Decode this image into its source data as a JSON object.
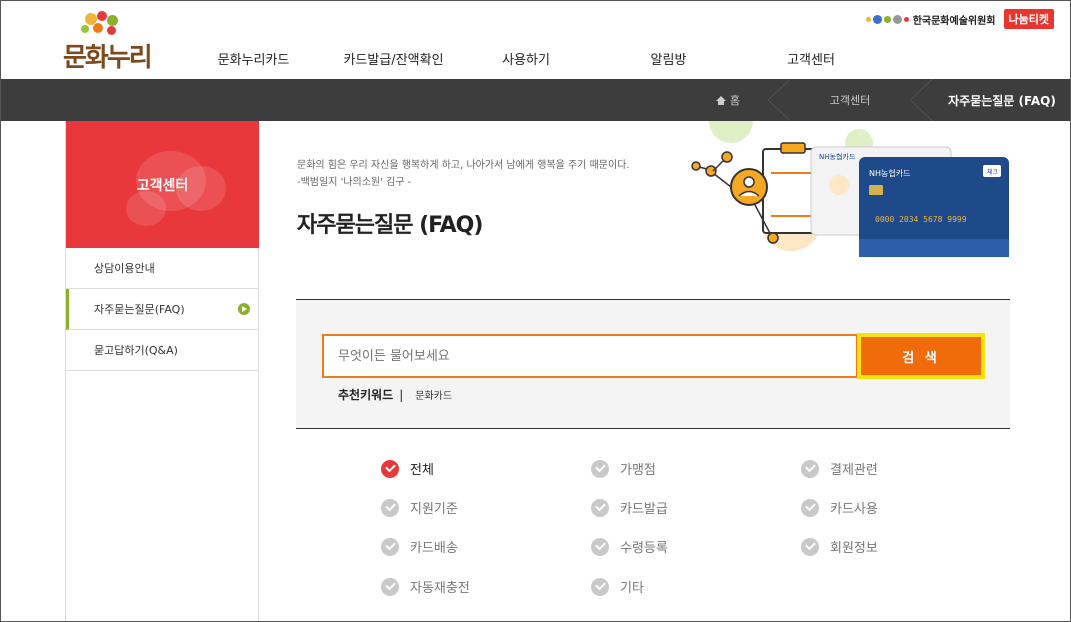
{
  "header": {
    "logo_text": "문화누리",
    "gnb": [
      "문화누리카드",
      "카드발급/잔액확인",
      "사용하기",
      "알림방",
      "고객센터"
    ],
    "arko_label": "한국문화예술위원회",
    "nanum_label": "나눔티켓"
  },
  "breadcrumb": {
    "home": "홈",
    "section": "고객센터",
    "current": "자주묻는질문 (FAQ)"
  },
  "sidebar": {
    "title": "고객센터",
    "items": [
      {
        "label": "상담이용안내"
      },
      {
        "label": "자주묻는질문(FAQ)"
      },
      {
        "label": "묻고답하기(Q&A)"
      }
    ]
  },
  "intro": {
    "quote_line1": "문화의 힘은 우리 자신을 행복하게 하고, 나아가서 남에게 행복을 주기 때문이다.",
    "quote_line2": "-백범일지 '나의소원' 김구 -",
    "title": "자주묻는질문 (FAQ)"
  },
  "visual": {
    "card_bank": "NH농협카드",
    "card_number": "0000 2034 5678 9999",
    "card_tag": "체크"
  },
  "search": {
    "placeholder": "무엇이든 물어보세요",
    "button": "검 색",
    "keyword_label": "추천키워드",
    "keyword_sep": "|",
    "keywords": [
      "문화카드"
    ]
  },
  "categories": [
    {
      "label": "전체",
      "active": true
    },
    {
      "label": "가맹점",
      "active": false
    },
    {
      "label": "결제관련",
      "active": false
    },
    {
      "label": "지원기준",
      "active": false
    },
    {
      "label": "카드발급",
      "active": false
    },
    {
      "label": "카드사용",
      "active": false
    },
    {
      "label": "카드배송",
      "active": false
    },
    {
      "label": "수령등록",
      "active": false
    },
    {
      "label": "회원정보",
      "active": false
    },
    {
      "label": "자동재충전",
      "active": false
    },
    {
      "label": "기타",
      "active": false
    }
  ],
  "colors": {
    "accent_red": "#e8383b",
    "search_orange": "#f26b0a",
    "highlight_yellow": "#f6e30b",
    "nav_dark": "#3d3d3d",
    "active_green": "#8bb02a"
  }
}
